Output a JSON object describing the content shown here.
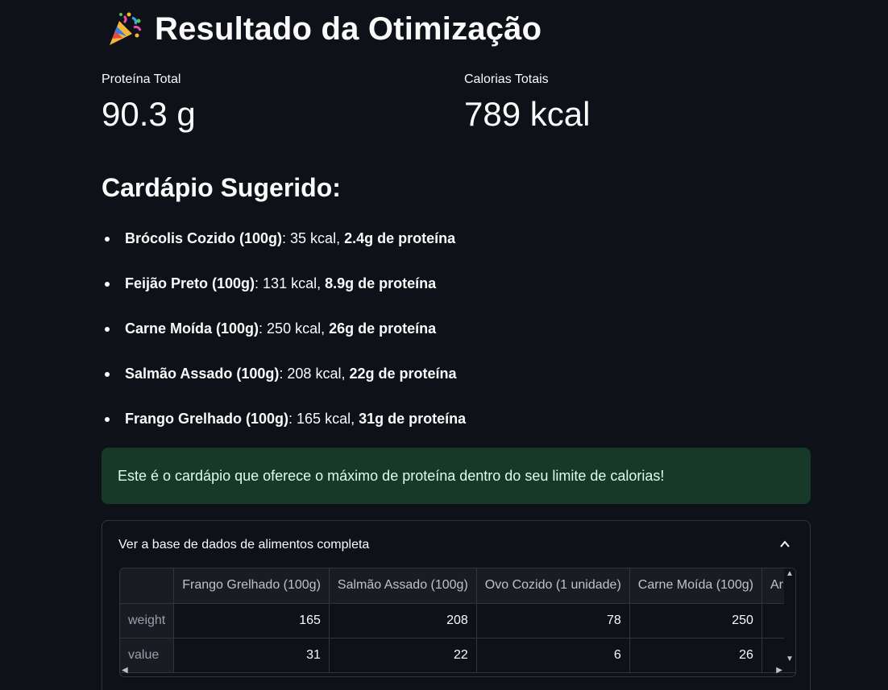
{
  "header": {
    "title": "Resultado da Otimização",
    "icon": "party-popper-icon"
  },
  "metrics": [
    {
      "label": "Proteína Total",
      "value": "90.3 g"
    },
    {
      "label": "Calorias Totais",
      "value": "789 kcal"
    }
  ],
  "menu": {
    "heading": "Cardápio Sugerido:",
    "items": [
      {
        "name": "Brócolis Cozido (100g)",
        "kcal": ": 35 kcal, ",
        "protein": "2.4g de proteína"
      },
      {
        "name": "Feijão Preto (100g)",
        "kcal": ": 131 kcal, ",
        "protein": "8.9g de proteína"
      },
      {
        "name": "Carne Moída (100g)",
        "kcal": ": 250 kcal, ",
        "protein": "26g de proteína"
      },
      {
        "name": "Salmão Assado (100g)",
        "kcal": ": 208 kcal, ",
        "protein": "22g de proteína"
      },
      {
        "name": "Frango Grelhado (100g)",
        "kcal": ": 165 kcal, ",
        "protein": "31g de proteína"
      }
    ]
  },
  "success_message": "Este é o cardápio que oferece o máximo de proteína dentro do seu limite de calorias!",
  "expander": {
    "label": "Ver a base de dados de alimentos completa",
    "table": {
      "columns": [
        "",
        "Frango Grelhado (100g)",
        "Salmão Assado (100g)",
        "Ovo Cozido (1 unidade)",
        "Carne Moída (100g)",
        "Arr"
      ],
      "rows": [
        {
          "index": "weight",
          "values": [
            "165",
            "208",
            "78",
            "250",
            ""
          ]
        },
        {
          "index": "value",
          "values": [
            "31",
            "22",
            "6",
            "26",
            ""
          ]
        }
      ]
    }
  },
  "colors": {
    "background": "#0e1117",
    "success_bg": "#173928",
    "success_text": "#dffde9",
    "border": "#31333f"
  }
}
